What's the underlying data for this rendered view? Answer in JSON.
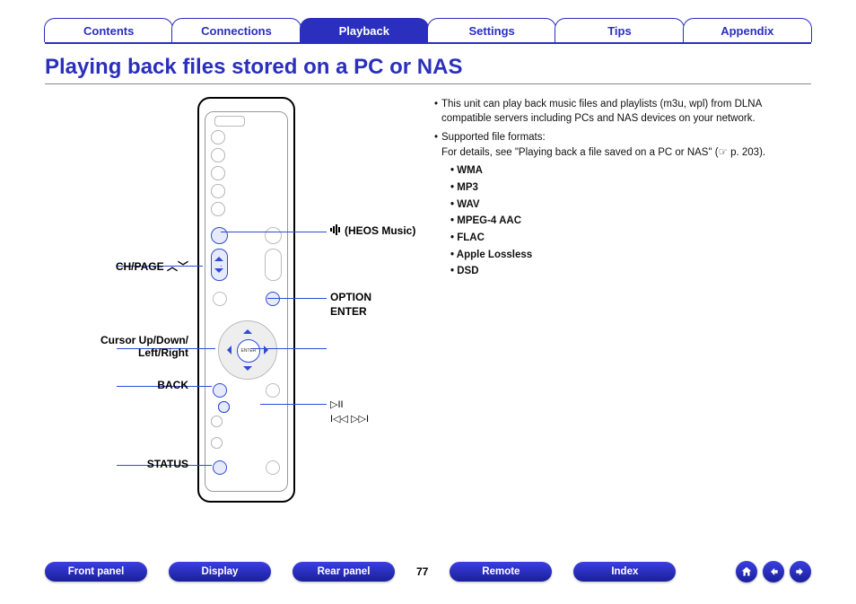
{
  "tabs": {
    "contents": "Contents",
    "connections": "Connections",
    "playback": "Playback",
    "settings": "Settings",
    "tips": "Tips",
    "appendix": "Appendix"
  },
  "title": "Playing back files stored on a PC or NAS",
  "callouts": {
    "heos": "(HEOS Music)",
    "chpage": "CH/PAGE",
    "option": "OPTION",
    "enter": "ENTER",
    "cursor": "Cursor Up/Down/\nLeft/Right",
    "back": "BACK",
    "status": "STATUS"
  },
  "notes": {
    "line1": "This unit can play back music files and playlists (m3u, wpl) from DLNA compatible servers including PCs and NAS devices on your network.",
    "line2a": "Supported file formats:",
    "line2b": "For details, see \"Playing back a file saved on a PC or NAS\" (☞ p. 203).",
    "formats": [
      "WMA",
      "MP3",
      "WAV",
      "MPEG-4 AAC",
      "FLAC",
      "Apple Lossless",
      "DSD"
    ]
  },
  "bottom": {
    "front": "Front panel",
    "display": "Display",
    "rear": "Rear panel",
    "page": "77",
    "remote": "Remote",
    "index": "Index"
  },
  "media_icons": {
    "playpause": "▷II",
    "prevnext": "▷▷I"
  }
}
